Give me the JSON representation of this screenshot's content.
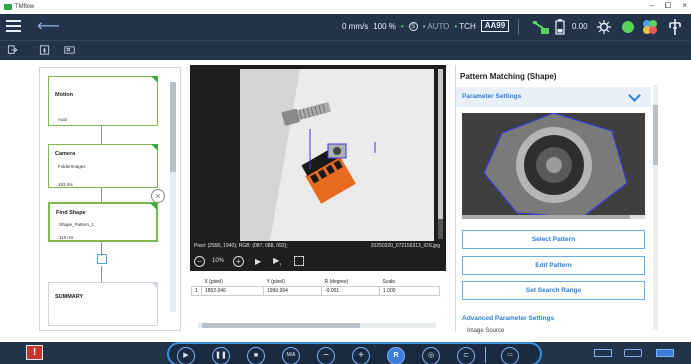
{
  "window": {
    "title": "TMflow",
    "controls": [
      "–",
      "⧠",
      "×"
    ]
  },
  "topbar": {
    "speed": "0 mm/s",
    "percent": "100 %",
    "s_mark": "S",
    "auto": "AUTO",
    "tch": "TCH",
    "project": "AA99",
    "count": "0.00"
  },
  "flow": {
    "cards": [
      {
        "title": "Motion",
        "sub": "Auto"
      },
      {
        "title": "Camera",
        "sub": "FolderImages",
        "sub2": "193 ms"
      },
      {
        "title": "Find Shape",
        "sub": "Shape_Pattern_1",
        "sub2": "118 ms"
      },
      {
        "title": "SUMMARY"
      }
    ]
  },
  "viewer": {
    "pixel_info": "Pixel: (2990, 1940); RGB: (087, 088, 092);",
    "filename": "20250320_072156313_iOS.jpg",
    "zoom": "10%"
  },
  "results": {
    "headers": [
      "X (pixel)",
      "Y (pixel)",
      "R (degree)",
      "Scale"
    ],
    "rows": [
      {
        "index": "1",
        "x": "1802.046",
        "y": "1990.994",
        "r": "-0.001",
        "scale": "1.000"
      }
    ]
  },
  "right_panel": {
    "title": "Pattern Matching (Shape)",
    "section": "Parameter Settings",
    "buttons": {
      "select": "Select Pattern",
      "edit": "Edit Pattern",
      "range": "Set Search Range"
    },
    "advanced": "Advanced Parameter Settings",
    "image_source": "Image Source"
  },
  "bottombar": {
    "alert": "!",
    "ma_label": "M/A",
    "r_label": "R"
  },
  "colors": {
    "navy": "#233349",
    "accent_blue": "#2d7fd4",
    "green": "#58d65a",
    "alert_red": "#c0392b"
  }
}
